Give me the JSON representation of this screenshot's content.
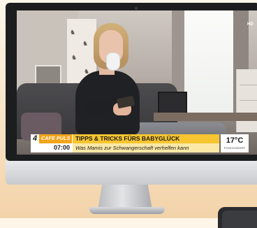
{
  "channel": {
    "logo_number": "4",
    "logo_text": "CAFE PULS",
    "time": "07:00",
    "quality_badge": "HD"
  },
  "ticker": {
    "headline": "TIPPS & TRICKS FÜRS BABYGLÜCK",
    "subline": "Was Mamis zur Schwangerschaft verhelfen kann"
  },
  "weather": {
    "temperature": "17°C",
    "location": "FOOCKSDORF"
  },
  "colors": {
    "accent_orange": "#f2a41a",
    "headline_yellow": "#f7c531",
    "subline_yellow": "#fbe8a6",
    "bezel": "#1c1d1f"
  },
  "icons": [
    "webcam-icon"
  ]
}
